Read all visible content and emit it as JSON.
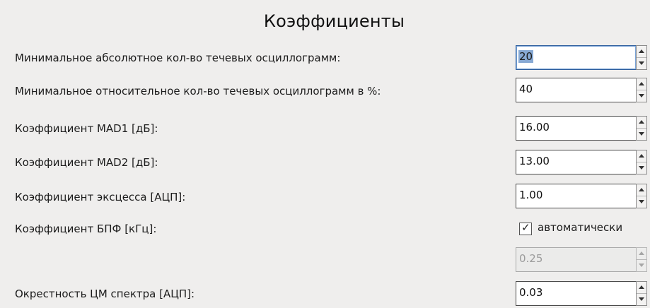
{
  "panel": {
    "title": "Коэффициенты"
  },
  "rows": [
    {
      "label": "Минимальное абсолютное кол-во течевых осциллограмм:",
      "value": "20"
    },
    {
      "label": "Минимальное относительное кол-во течевых осциллограмм в %:",
      "value": "40"
    },
    {
      "label": "Коэффициент MAD1 [дБ]:",
      "value": "16.00"
    },
    {
      "label": "Коэффициент MAD2 [дБ]:",
      "value": "13.00"
    },
    {
      "label": "Коэффициент эксцесса [АЦП]:",
      "value": "1.00"
    },
    {
      "label": "Коэффициент БПФ [кГц]:",
      "value": "0.25"
    },
    {
      "label": "Окрестность ЦМ спектра [АЦП]:",
      "value": "0.03"
    }
  ],
  "fft_auto": {
    "label": "автоматически",
    "checked": true,
    "check_glyph": "✓"
  },
  "icons": {
    "spin_up": "spin-up-arrow-icon",
    "spin_down": "spin-down-arrow-icon",
    "checkmark": "checkmark-icon"
  },
  "colors": {
    "background": "#efeeed",
    "selection": "#87a9d4",
    "focus_border": "#2f5f9e"
  }
}
